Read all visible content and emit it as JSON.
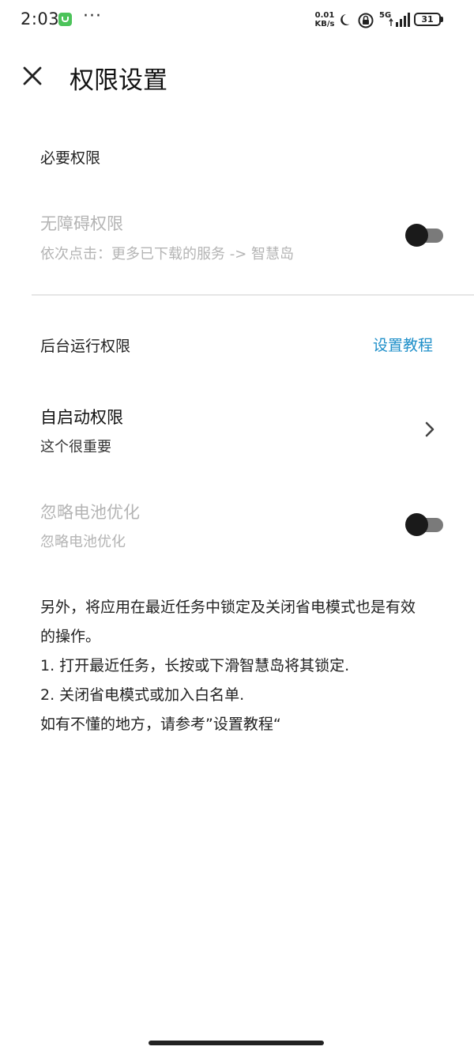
{
  "status_bar": {
    "time": "2:03",
    "more": "···",
    "net_speed_value": "0.01",
    "net_speed_unit": "KB/s",
    "network_type": "5G",
    "battery": "31"
  },
  "header": {
    "title": "权限设置"
  },
  "sections": {
    "required": {
      "header": "必要权限",
      "accessibility": {
        "title": "无障碍权限",
        "subtitle": "依次点击：更多已下载的服务 -> 智慧岛",
        "enabled": false
      }
    },
    "background": {
      "header": "后台运行权限",
      "tutorial_link": "设置教程",
      "autostart": {
        "title": "自启动权限",
        "subtitle": "这个很重要"
      },
      "battery_opt": {
        "title": "忽略电池优化",
        "subtitle": "忽略电池优化",
        "enabled": false
      }
    }
  },
  "note": {
    "line1": "另外，将应用在最近任务中锁定及关闭省电模式也是有效",
    "line2": "的操作。",
    "line3": "1. 打开最近任务，长按或下滑智慧岛将其锁定.",
    "line4": "2. 关闭省电模式或加入白名单.",
    "line5": "如有不懂的地方，请参考”设置教程“"
  },
  "colors": {
    "link": "#1e8fc9",
    "disabled_text": "#b4b4b4",
    "toggle_thumb": "#1a1a1a",
    "toggle_track": "#7a7a7a"
  }
}
